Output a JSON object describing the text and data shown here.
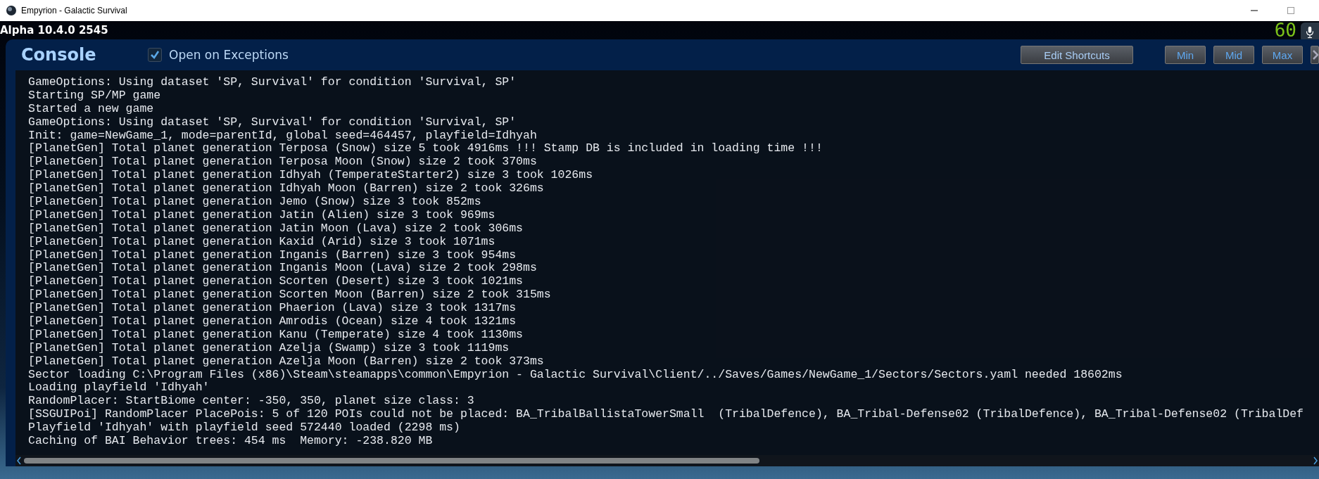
{
  "window": {
    "title": "Empyrion - Galactic Survival"
  },
  "version": "Alpha 10.4.0 2545",
  "fps": "60",
  "console": {
    "title": "Console",
    "open_on_exceptions": {
      "label": "Open on Exceptions",
      "checked": true
    },
    "edit_button": "Edit Shortcuts",
    "size_buttons": [
      "Min",
      "Mid",
      "Max"
    ],
    "log": [
      "GameOptions: Using dataset 'SP, Survival' for condition 'Survival, SP'",
      "Starting SP/MP game",
      "Started a new game",
      "GameOptions: Using dataset 'SP, Survival' for condition 'Survival, SP'",
      "Init: game=NewGame_1, mode=parentId, global seed=464457, playfield=Idhyah",
      "[PlanetGen] Total planet generation Terposa (Snow) size 5 took 4916ms !!! Stamp DB is included in loading time !!!",
      "[PlanetGen] Total planet generation Terposa Moon (Snow) size 2 took 370ms",
      "[PlanetGen] Total planet generation Idhyah (TemperateStarter2) size 3 took 1026ms",
      "[PlanetGen] Total planet generation Idhyah Moon (Barren) size 2 took 326ms",
      "[PlanetGen] Total planet generation Jemo (Snow) size 3 took 852ms",
      "[PlanetGen] Total planet generation Jatin (Alien) size 3 took 969ms",
      "[PlanetGen] Total planet generation Jatin Moon (Lava) size 2 took 306ms",
      "[PlanetGen] Total planet generation Kaxid (Arid) size 3 took 1071ms",
      "[PlanetGen] Total planet generation Inganis (Barren) size 3 took 954ms",
      "[PlanetGen] Total planet generation Inganis Moon (Lava) size 2 took 298ms",
      "[PlanetGen] Total planet generation Scorten (Desert) size 3 took 1021ms",
      "[PlanetGen] Total planet generation Scorten Moon (Barren) size 2 took 315ms",
      "[PlanetGen] Total planet generation Phaerion (Lava) size 3 took 1317ms",
      "[PlanetGen] Total planet generation Amrodis (Ocean) size 4 took 1321ms",
      "[PlanetGen] Total planet generation Kanu (Temperate) size 4 took 1130ms",
      "[PlanetGen] Total planet generation Azelja (Swamp) size 3 took 1119ms",
      "[PlanetGen] Total planet generation Azelja Moon (Barren) size 2 took 373ms",
      "Sector loading C:\\Program Files (x86)\\Steam\\steamapps\\common\\Empyrion - Galactic Survival\\Client/../Saves/Games/NewGame_1/Sectors/Sectors.yaml needed 18602ms",
      "Loading playfield 'Idhyah'",
      "RandomPlacer: StartBiome center: -350, 350, planet size class: 3",
      "[SSGUIPoi] RandomPlacer PlacePois: 5 of 120 POIs could not be placed: BA_TribalBallistaTowerSmall  (TribalDefence), BA_Tribal-Defense02 (TribalDefence), BA_Tribal-Defense02 (TribalDef",
      "Playfield 'Idhyah' with playfield seed 572440 loaded (2298 ms)",
      "Caching of BAI Behavior trees: 454 ms  Memory: -238.820 MB"
    ]
  }
}
